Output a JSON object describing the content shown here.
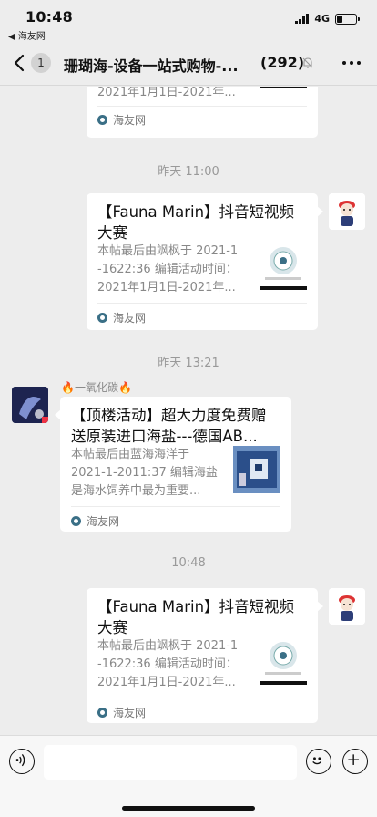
{
  "status": {
    "time": "10:48",
    "back_app": "◀ 海友网",
    "network": "4G"
  },
  "nav": {
    "badge": "1",
    "title": "珊瑚海-设备一站式购物-...",
    "count": "(292)"
  },
  "messages": [
    {
      "desc_lines": [
        "2021年1月1日-2021年..."
      ],
      "source": "海友网"
    },
    {
      "time": "昨天 11:00",
      "title": "【Fauna Marin】抖音短视频大赛",
      "desc_lines": [
        "本帖最后由飒枫于 2021-1",
        "-1622:36 编辑活动时间：",
        "2021年1月1日-2021年..."
      ],
      "source": "海友网"
    },
    {
      "time": "昨天 13:21",
      "sender": "🔥一氧化碳🔥",
      "title": "【顶楼活动】超大力度免费赠送原装进口海盐---德国AB...",
      "desc_lines": [
        "本帖最后由蓝海海洋于",
        "2021-1-2011:37 编辑海盐",
        "是海水饲养中最为重要..."
      ],
      "source": "海友网"
    },
    {
      "time": "10:48",
      "title": "【Fauna Marin】抖音短视频大赛",
      "desc_lines": [
        "本帖最后由飒枫于 2021-1",
        "-1622:36 编辑活动时间：",
        "2021年1月1日-2021年..."
      ],
      "source": "海友网"
    }
  ],
  "input": {
    "placeholder": ""
  },
  "colors": {
    "background": "#ededed",
    "card": "#ffffff",
    "muted_text": "#888888",
    "source_icon": "#3a6f86"
  }
}
